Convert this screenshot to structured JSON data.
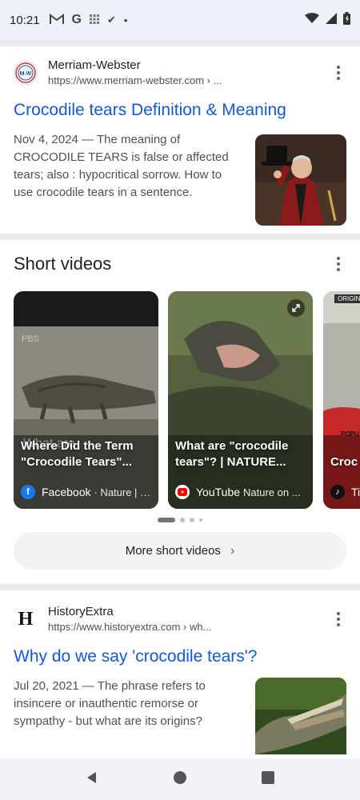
{
  "status_bar": {
    "time": "10:21",
    "left_icons": [
      "gmail-icon",
      "google-icon",
      "grid-icon",
      "check-icon",
      "dot-icon"
    ],
    "right_icons": [
      "wifi-icon",
      "signal-icon",
      "battery-icon"
    ]
  },
  "results": [
    {
      "site_name": "Merriam-Webster",
      "site_url": "https://www.merriam-webster.com › ...",
      "favicon_text": "M-W",
      "title": "Crocodile tears Definition & Meaning",
      "snippet": "Nov 4, 2024 — The meaning of CROCODILE TEARS is false or affected tears; also : hypocritical sorrow. How to use crocodile tears in a sentence."
    },
    {
      "site_name": "HistoryExtra",
      "site_url": "https://www.historyextra.com › wh...",
      "favicon_text": "H",
      "title": "Why do we say 'crocodile tears'?",
      "snippet": "Jul 20, 2021 — The phrase refers to insincere or inauthentic remorse or sympathy - but what are its origins?"
    }
  ],
  "short_videos": {
    "title": "Short videos",
    "cards": [
      {
        "caption": "Where Did the Term \"Crocodile Tears\"...",
        "source": "Facebook",
        "meta": "· Nature | P...",
        "overlay_text": "What are",
        "watermark": "PBS"
      },
      {
        "caption": "What are \"crocodile tears\"? | NATURE...",
        "source": "YouTube",
        "meta": "Nature on ..."
      },
      {
        "caption": "Croc Popu",
        "source": "Ti",
        "badge": "ORIGIN",
        "sign_text": "POPU"
      }
    ],
    "more_label": "More short videos"
  },
  "colors": {
    "link": "#1558d6",
    "status_bg": "#eef1f8",
    "divider": "#e8eaed"
  }
}
